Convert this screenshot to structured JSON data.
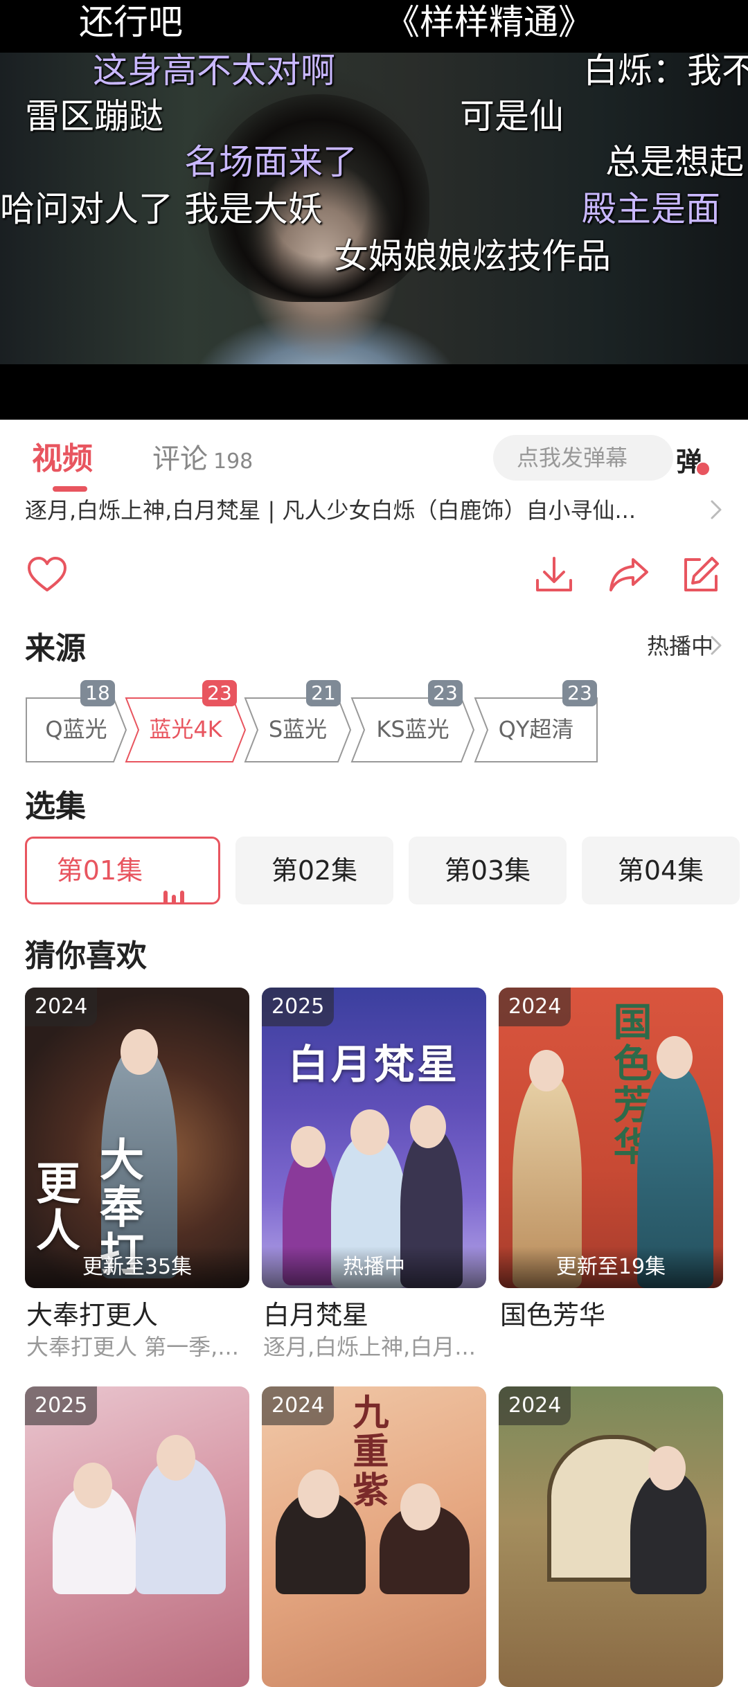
{
  "player": {
    "danmaku": [
      {
        "text": "还行吧",
        "color": "#ffffff"
      },
      {
        "text": "《样样精通》",
        "color": "#ffffff"
      },
      {
        "text": "这身高不太对啊",
        "color": "#c9b8ff"
      },
      {
        "text": "白烁：我不",
        "color": "#ffffff"
      },
      {
        "text": "雷区蹦跶",
        "color": "#ffffff"
      },
      {
        "text": "可是仙",
        "color": "#ffffff"
      },
      {
        "text": "名场面来了",
        "color": "#c9b8ff"
      },
      {
        "text": "总是想起",
        "color": "#ffffff"
      },
      {
        "text": "哈问对人了 我是大妖",
        "color": "#ffffff"
      },
      {
        "text": "殿主是面",
        "color": "#c9b8ff"
      },
      {
        "text": "女娲娘娘炫技作品",
        "color": "#ffffff"
      }
    ]
  },
  "tabs": {
    "video": "视频",
    "comments": "评论",
    "comments_count": "198",
    "danmu_placeholder": "点我发弹幕",
    "danmu_toggle": "弹"
  },
  "description": "逐月,白烁上神,白月梵星 | 凡人少女白烁（白鹿饰）自小寻仙...",
  "sources": {
    "heading": "来源",
    "more": "热播中",
    "items": [
      {
        "label": "Q蓝光",
        "count": "18",
        "active": false
      },
      {
        "label": "蓝光4K",
        "count": "23",
        "active": true
      },
      {
        "label": "S蓝光",
        "count": "21",
        "active": false
      },
      {
        "label": "KS蓝光",
        "count": "23",
        "active": false
      },
      {
        "label": "QY超清",
        "count": "23",
        "active": false
      }
    ]
  },
  "episodes": {
    "heading": "选集",
    "items": [
      {
        "label": "第01集",
        "active": true
      },
      {
        "label": "第02集",
        "active": false
      },
      {
        "label": "第03集",
        "active": false
      },
      {
        "label": "第04集",
        "active": false
      }
    ]
  },
  "recommend": {
    "heading": "猜你喜欢",
    "items": [
      {
        "year": "2024",
        "status": "更新至35集",
        "title": "大奉打更人",
        "subtitle": "大奉打更人 第一季,..."
      },
      {
        "year": "2025",
        "status": "热播中",
        "title": "白月梵星",
        "subtitle": "逐月,白烁上神,白月..."
      },
      {
        "year": "2024",
        "status": "更新至19集",
        "title": "国色芳华",
        "subtitle": ""
      },
      {
        "year": "2025",
        "status": "",
        "title": "",
        "subtitle": ""
      },
      {
        "year": "2024",
        "status": "",
        "title": "",
        "subtitle": ""
      },
      {
        "year": "2024",
        "status": "",
        "title": "",
        "subtitle": ""
      }
    ]
  },
  "poster_text": {
    "p1": "大奉打更人",
    "p2": "白月梵星",
    "p3": "国色芳华",
    "p5": "九重紫"
  },
  "colors": {
    "accent": "#e8555f",
    "badge_grey": "#7f8a96"
  }
}
